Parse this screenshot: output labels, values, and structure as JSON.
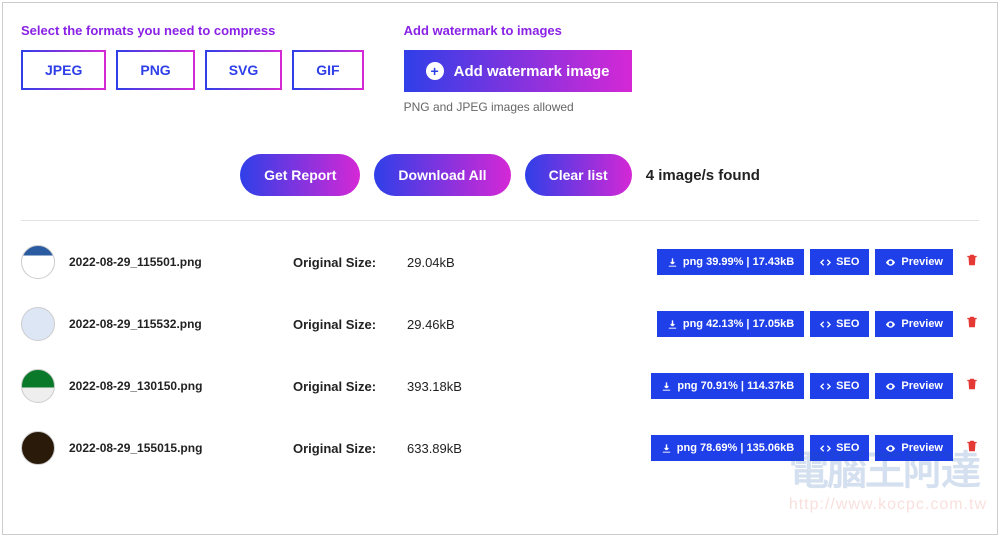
{
  "formats_label": "Select the formats you need to compress",
  "formats": [
    "JPEG",
    "PNG",
    "SVG",
    "GIF"
  ],
  "watermark": {
    "label": "Add watermark to images",
    "button": "Add watermark image",
    "hint": "PNG and JPEG images allowed"
  },
  "actions": {
    "report": "Get Report",
    "download_all": "Download All",
    "clear_list": "Clear list",
    "found": "4 image/s found"
  },
  "columns": {
    "original_size": "Original Size:"
  },
  "buttons": {
    "seo": "SEO",
    "preview": "Preview"
  },
  "rows": [
    {
      "file": "2022-08-29_115501.png",
      "size": "29.04kB",
      "download_label": "png  39.99% | 17.43kB"
    },
    {
      "file": "2022-08-29_115532.png",
      "size": "29.46kB",
      "download_label": "png  42.13% | 17.05kB"
    },
    {
      "file": "2022-08-29_130150.png",
      "size": "393.18kB",
      "download_label": "png  70.91% | 114.37kB"
    },
    {
      "file": "2022-08-29_155015.png",
      "size": "633.89kB",
      "download_label": "png  78.69% | 135.06kB"
    }
  ]
}
